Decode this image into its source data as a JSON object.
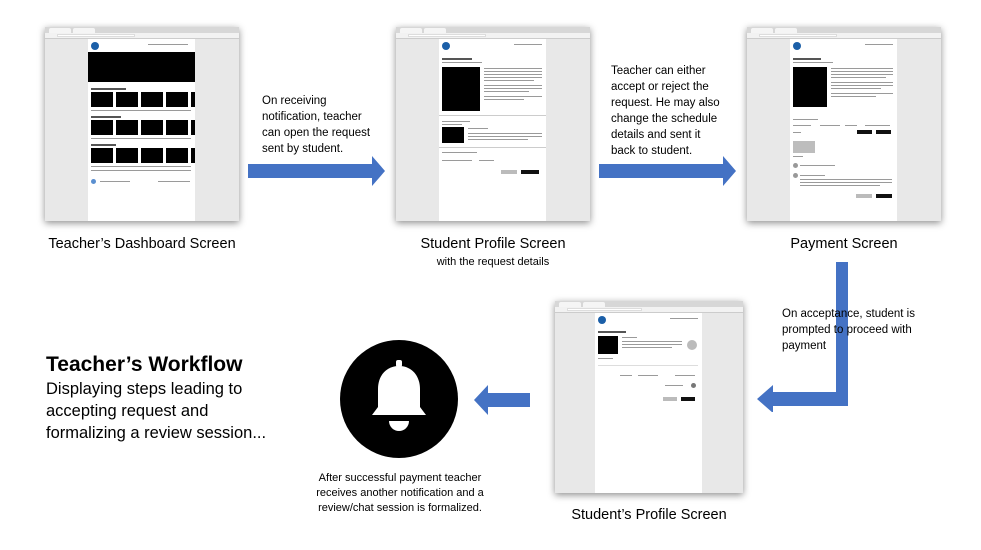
{
  "screens": {
    "dashboard": {
      "caption": "Teacher’s Dashboard Screen"
    },
    "student_profile": {
      "caption": "Student Profile Screen",
      "subcaption": "with the request details"
    },
    "payment": {
      "caption": "Payment Screen"
    },
    "student_profile_2": {
      "caption": "Student’s Profile Screen"
    }
  },
  "notes": {
    "step1": [
      "On receiving",
      "notification, teacher",
      "can open the request",
      "sent by student."
    ],
    "step2": [
      "Teacher can either",
      "accept or reject the",
      "request. He may also",
      "change the schedule",
      "details and sent it",
      "back to student."
    ],
    "step3": [
      "On acceptance, student is",
      "prompted to proceed with",
      "payment"
    ],
    "step4": [
      "After successful payment teacher",
      "receives another notification and a",
      "review/chat session is formalized."
    ]
  },
  "workflow": {
    "title": "Teacher’s Workflow",
    "subtitle": [
      "Displaying steps leading to",
      "accepting request and",
      "formalizing a review session..."
    ]
  },
  "icons": {
    "notification": "bell-icon",
    "arrow": "arrow-icon"
  },
  "colors": {
    "arrow": "#4472c4",
    "bell_circle": "#000000"
  }
}
